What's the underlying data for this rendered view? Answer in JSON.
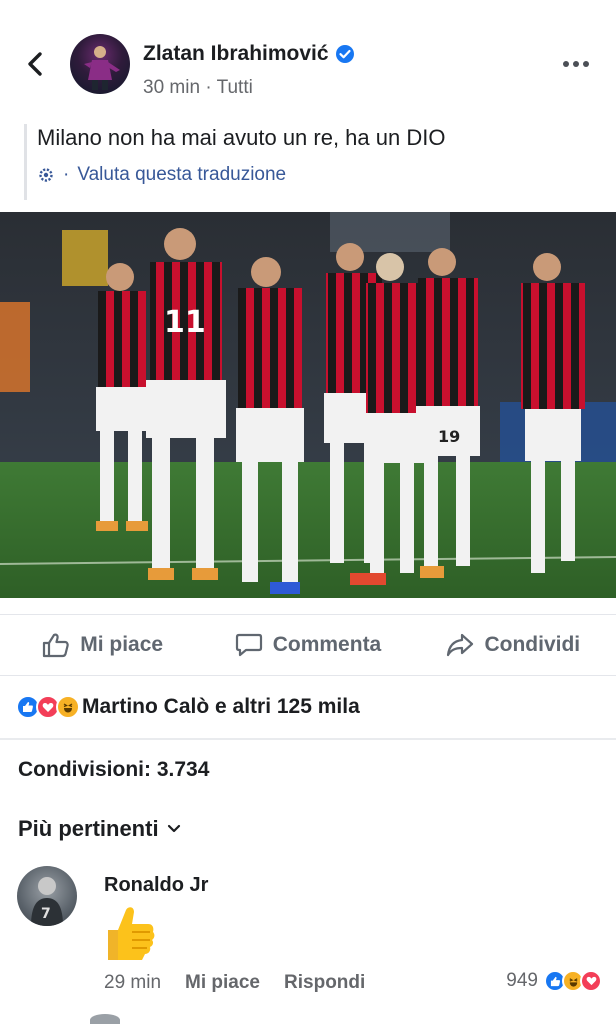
{
  "post": {
    "author": "Zlatan Ibrahimović",
    "time": "30 min",
    "separator": "·",
    "audience": "Tutti",
    "text": "Milano non ha mai avuto un re, ha un DIO",
    "translate_label": "Valuta questa traduzione",
    "translate_prefix": "·"
  },
  "actions": {
    "like": "Mi piace",
    "comment": "Commenta",
    "share": "Condividi"
  },
  "reactions": {
    "summary": "Martino Calò e altri 125 mila",
    "types": [
      "like-icon",
      "love-icon",
      "haha-icon"
    ]
  },
  "shares": {
    "label": "Condivisioni: 3.734"
  },
  "comments": {
    "sort_label": "Più pertinenti",
    "items": [
      {
        "author": "Ronaldo Jr",
        "content_icon": "thumbs-up-emoji",
        "time": "29 min",
        "like": "Mi piace",
        "reply": "Rispondi",
        "reaction_count": "949",
        "reaction_types": [
          "like-icon",
          "haha-icon",
          "love-icon"
        ]
      }
    ]
  },
  "colors": {
    "facebook_blue": "#1877f2",
    "link_blue": "#385898",
    "love_red": "#f33e58",
    "haha_yellow": "#f7b125",
    "milan_red": "#c8102e"
  }
}
